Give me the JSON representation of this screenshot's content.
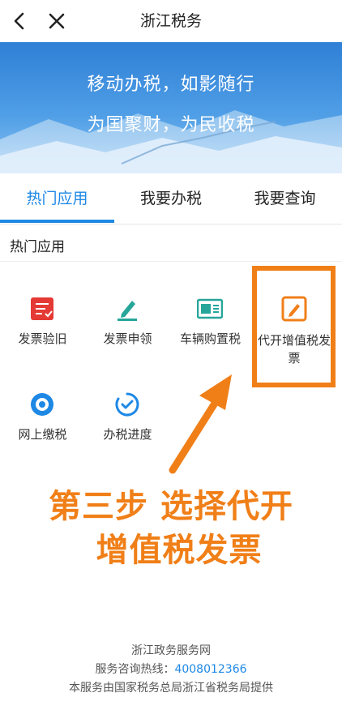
{
  "topbar": {
    "title": "浙江税务"
  },
  "banner": {
    "line1": "移动办税，如影随行",
    "line2": "为国聚财，为民收税"
  },
  "tabs": [
    {
      "label": "热门应用",
      "active": true
    },
    {
      "label": "我要办税",
      "active": false
    },
    {
      "label": "我要查询",
      "active": false
    }
  ],
  "section": {
    "title": "热门应用"
  },
  "apps": [
    {
      "label": "发票验旧",
      "icon": "invoice-check-icon",
      "color": "#e53935"
    },
    {
      "label": "发票申领",
      "icon": "invoice-apply-icon",
      "color": "#26a69a"
    },
    {
      "label": "车辆购置税",
      "icon": "vehicle-tax-icon",
      "color": "#26a69a"
    },
    {
      "label": "代开增值税发票",
      "icon": "vat-invoice-icon",
      "color": "#f07f18"
    },
    {
      "label": "网上缴税",
      "icon": "online-pay-icon",
      "color": "#1e88e5"
    },
    {
      "label": "办税进度",
      "icon": "progress-icon",
      "color": "#1e88e5"
    }
  ],
  "annotation": {
    "line1": "第三步 选择代开",
    "line2": "增值税发票",
    "color": "#f07f18"
  },
  "footer": {
    "line1": "浙江政务服务网",
    "hotline_label": "服务咨询热线：",
    "hotline_number": "4008012366",
    "line3": "本服务由国家税务总局浙江省税务局提供"
  }
}
